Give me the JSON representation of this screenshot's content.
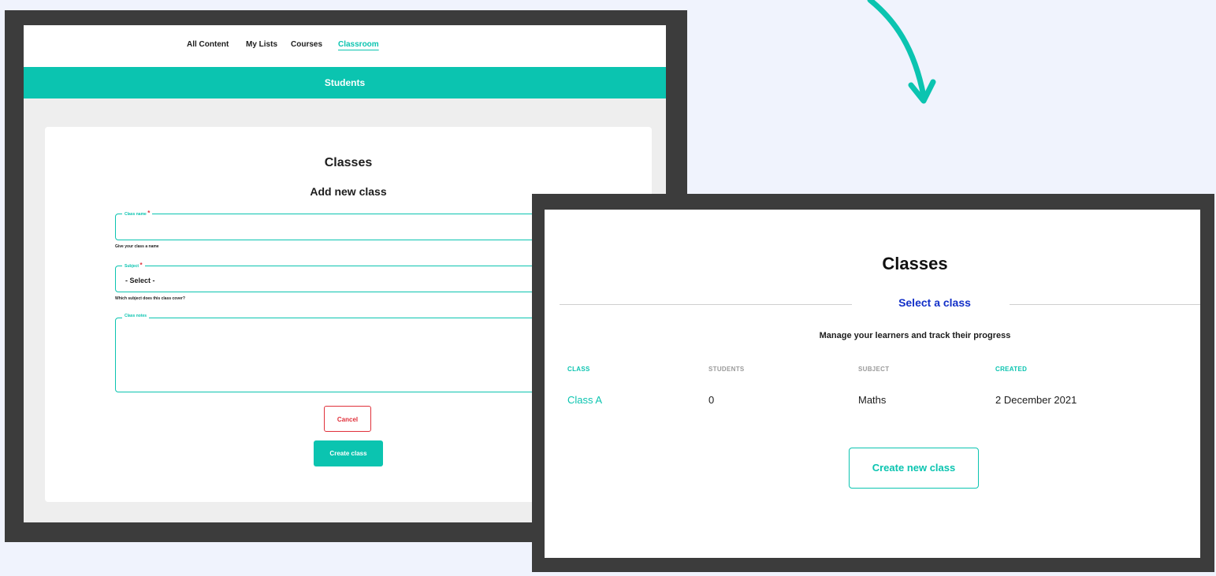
{
  "colors": {
    "accent": "#0bc4b0",
    "danger": "#e0303a",
    "link_blue": "#1330c8",
    "page_bg": "#f0f3fd",
    "frame": "#3c3c3c"
  },
  "icons": {
    "arrow": "curved-arrow-down-icon"
  },
  "left_screen": {
    "nav": [
      "All Content",
      "My Lists",
      "Courses",
      "Classroom"
    ],
    "active_nav": "Classroom",
    "banner": "Students",
    "card": {
      "title": "Classes",
      "subtitle": "Add new class",
      "class_name": {
        "label": "Class name",
        "required": "*",
        "value": "",
        "helper": "Give your class a name"
      },
      "subject": {
        "label": "Subject",
        "required": "*",
        "value": "- Select -",
        "helper": "Which subject does this class cover?"
      },
      "class_notes": {
        "label": "Class notes",
        "value": ""
      },
      "cancel_label": "Cancel",
      "create_label": "Create class"
    }
  },
  "right_screen": {
    "title": "Classes",
    "section_label": "Select a class",
    "description": "Manage your learners and track their progress",
    "table": {
      "headers": [
        "CLASS",
        "STUDENTS",
        "SUBJECT",
        "CREATED"
      ],
      "rows": [
        [
          "Class A",
          "0",
          "Maths",
          "2 December 2021"
        ]
      ]
    },
    "create_new_label": "Create new class"
  }
}
